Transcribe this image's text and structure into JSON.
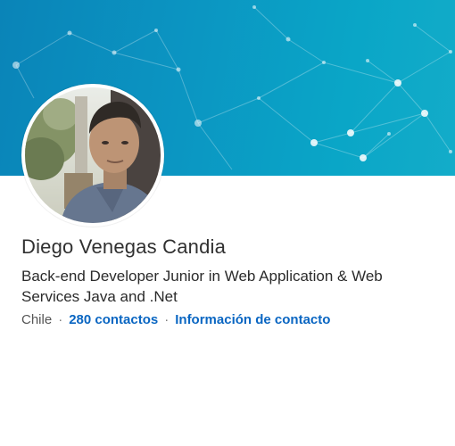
{
  "profile": {
    "name": "Diego Venegas Candia",
    "headline": "Back-end Developer Junior in Web Application & Web Services Java and .Net",
    "location": "Chile",
    "separator": "·",
    "connections_label": "280 contactos",
    "contact_info_label": "Información de contacto"
  },
  "colors": {
    "banner": "#0b95c2",
    "link": "#0a66c2",
    "name_text": "#303030"
  },
  "icons": {
    "avatar": "profile-photo"
  }
}
